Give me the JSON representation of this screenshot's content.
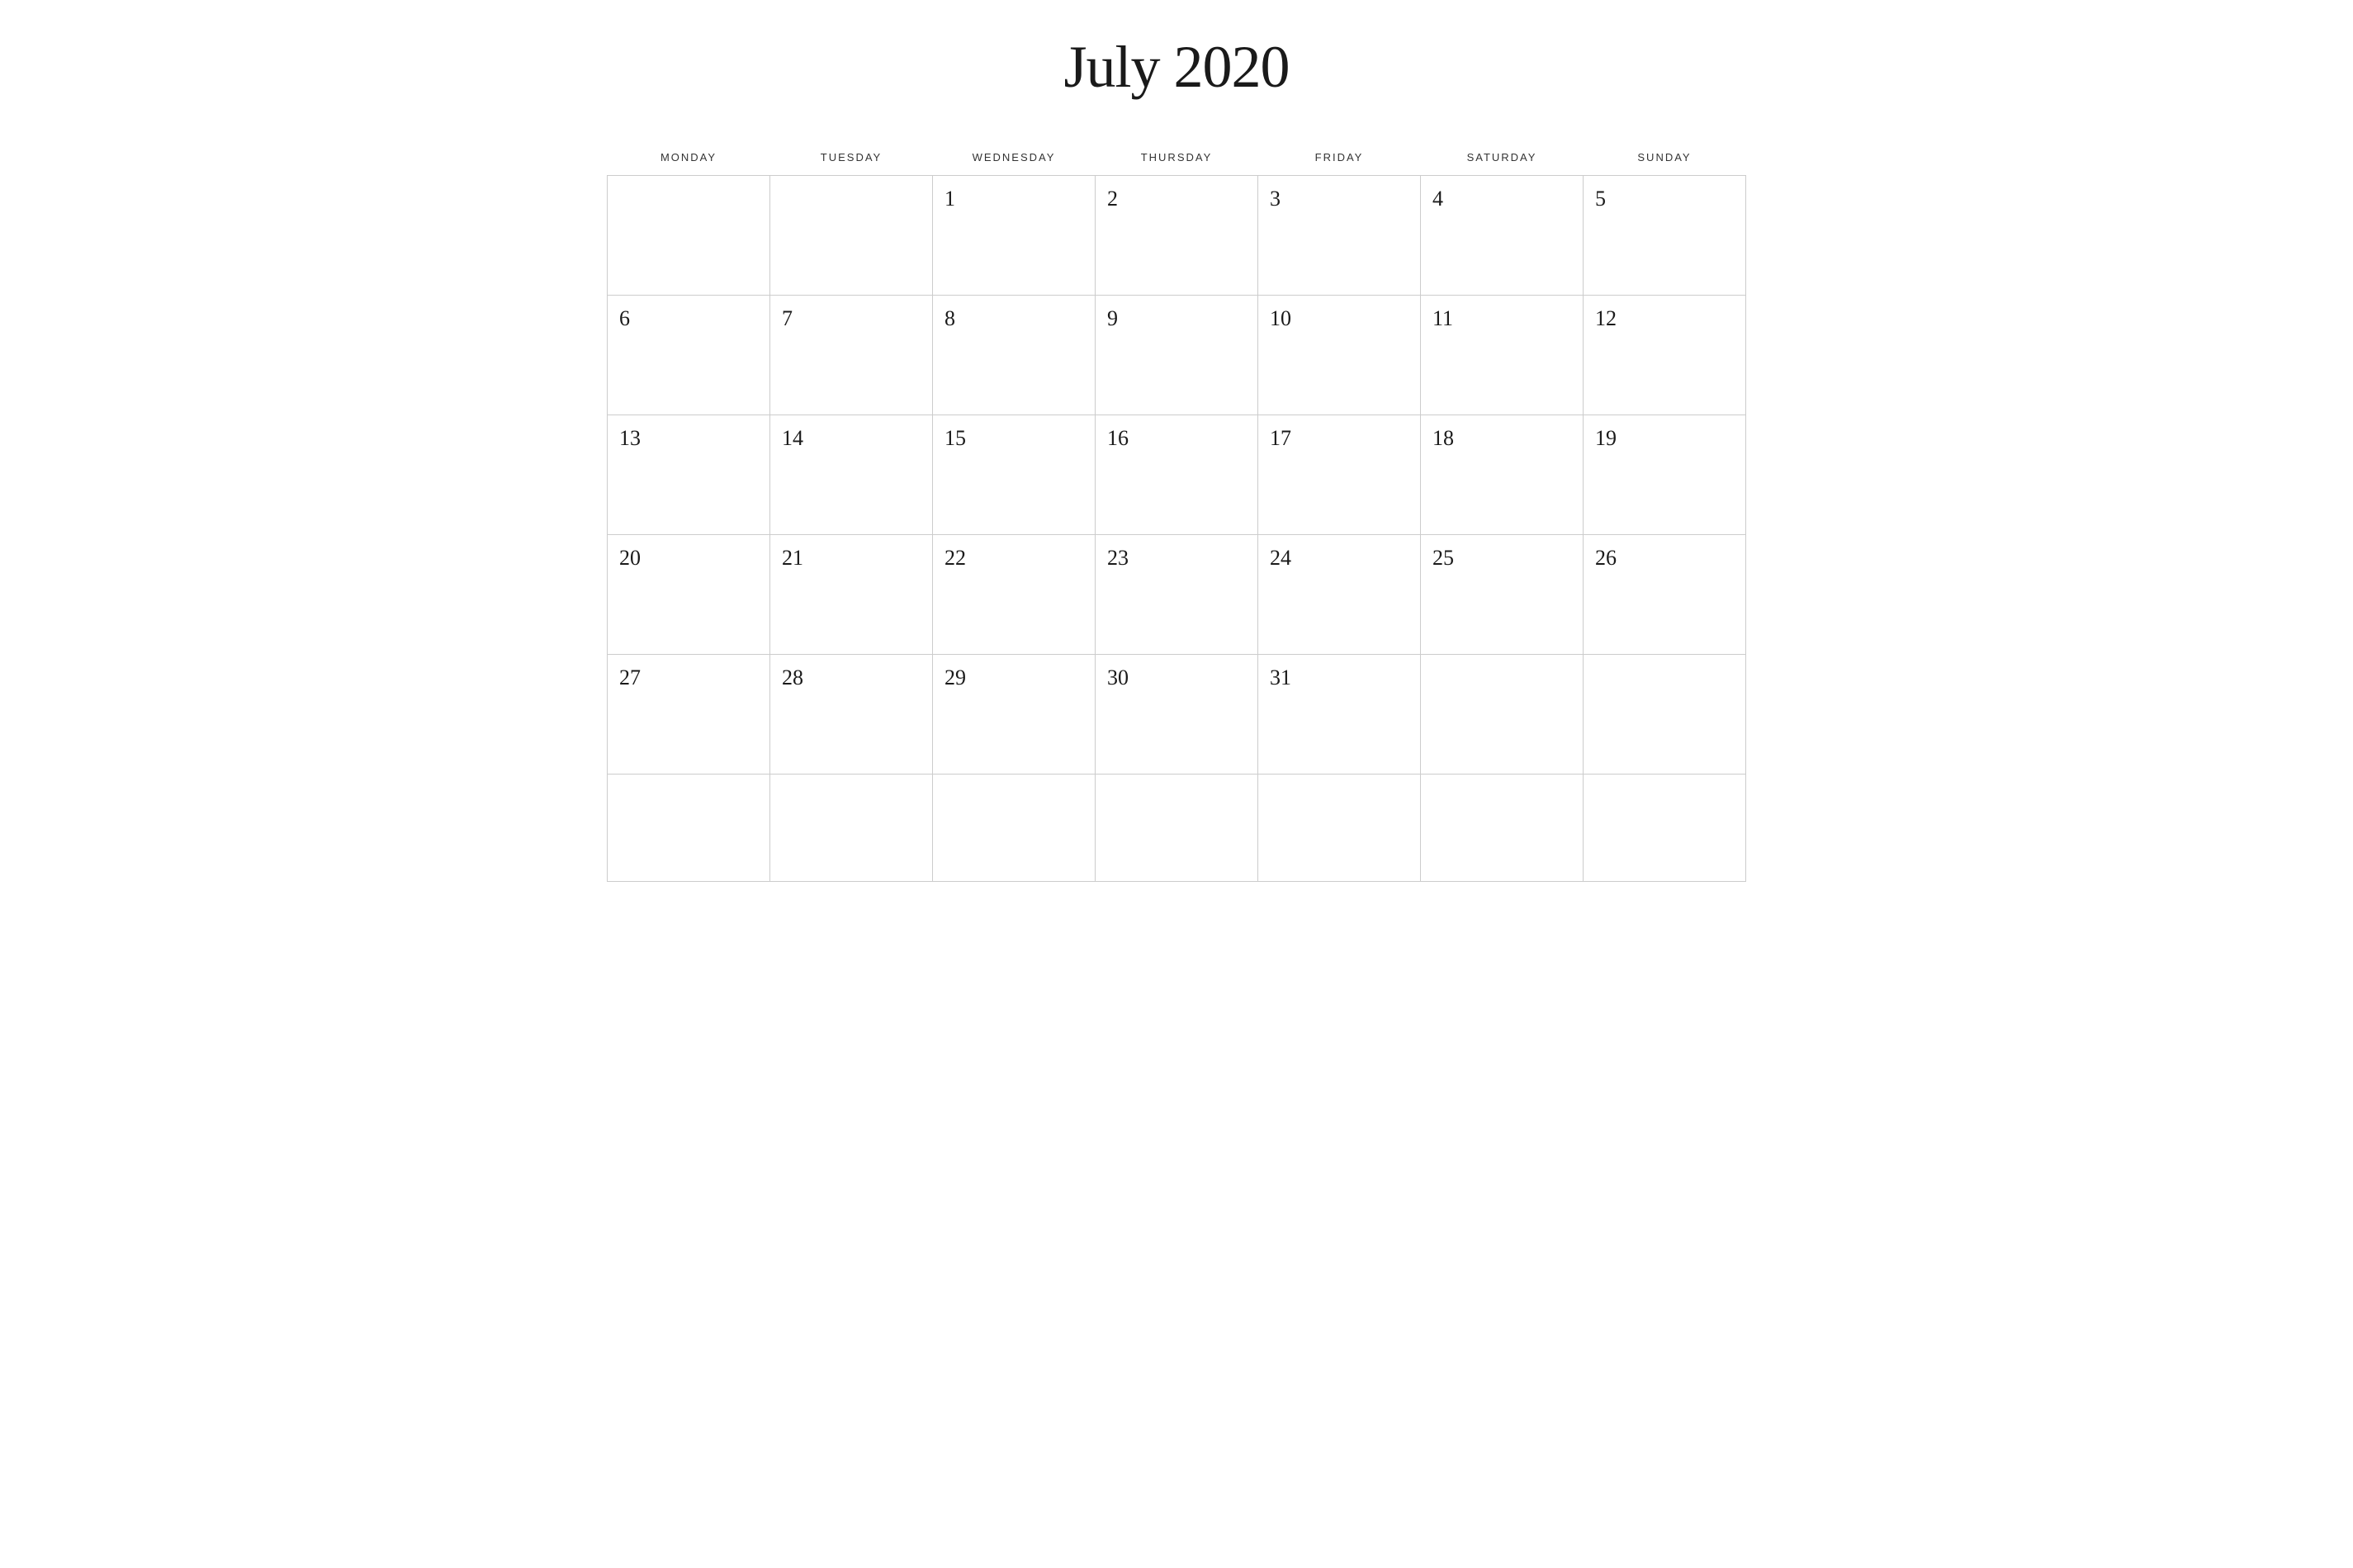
{
  "calendar": {
    "title": "July 2020",
    "headers": [
      "MONDAY",
      "TUESDAY",
      "WEDNESDAY",
      "THURSDAY",
      "FRIDAY",
      "SATURDAY",
      "SUNDAY"
    ],
    "weeks": [
      [
        null,
        null,
        1,
        2,
        3,
        4,
        5
      ],
      [
        6,
        7,
        8,
        9,
        10,
        11,
        12
      ],
      [
        13,
        14,
        15,
        16,
        17,
        18,
        19
      ],
      [
        20,
        21,
        22,
        23,
        24,
        25,
        26
      ],
      [
        27,
        28,
        29,
        30,
        31,
        null,
        null
      ],
      [
        null,
        null,
        null,
        null,
        null,
        null,
        null
      ]
    ]
  }
}
